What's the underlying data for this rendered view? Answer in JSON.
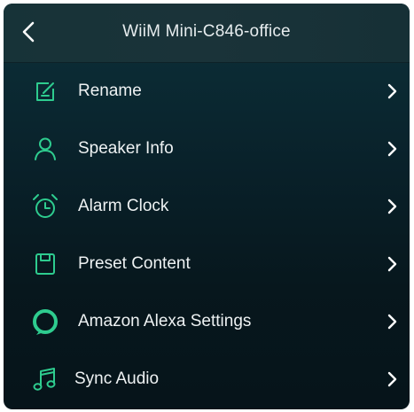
{
  "colors": {
    "accent": "#2ecc8f",
    "text": "#eef2f3",
    "header_bg": "#1a3339",
    "body_bg": "#07171d"
  },
  "header": {
    "back_icon": "chevron-left-icon",
    "title": "WiiM Mini-C846-office"
  },
  "menu": {
    "items": [
      {
        "label": "Rename",
        "icon": "edit-icon"
      },
      {
        "label": "Speaker Info",
        "icon": "user-icon"
      },
      {
        "label": "Alarm Clock",
        "icon": "alarm-clock-icon"
      },
      {
        "label": "Preset Content",
        "icon": "preset-icon"
      },
      {
        "label": "Amazon Alexa Settings",
        "icon": "alexa-icon"
      },
      {
        "label": "Sync Audio",
        "icon": "music-note-icon"
      }
    ]
  }
}
